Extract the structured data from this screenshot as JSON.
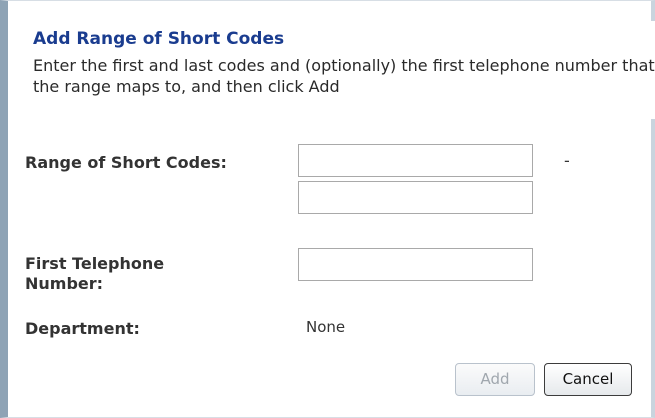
{
  "dialog": {
    "title": "Add Range of Short Codes",
    "instructions": "Enter the first and last codes and (optionally) the first telephone number that the range maps to, and then click Add"
  },
  "form": {
    "range_label": "Range of Short Codes:",
    "range_first_value": "",
    "range_last_value": "",
    "range_separator": "-",
    "first_phone_label_line1": "First Telephone",
    "first_phone_label_line2": "Number:",
    "first_phone_value": "",
    "department_label": "Department:",
    "department_value": "None"
  },
  "buttons": {
    "add_label": "Add",
    "add_enabled": false,
    "cancel_label": "Cancel"
  },
  "colors": {
    "title": "#1a3c8f",
    "left_border": "#8ea3b5"
  }
}
